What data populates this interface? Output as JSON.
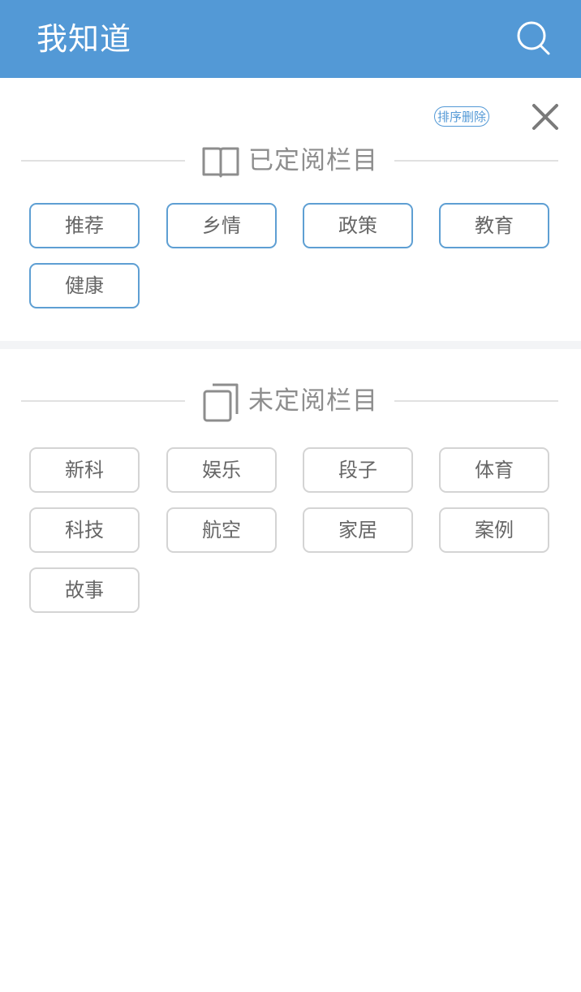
{
  "header": {
    "title": "我知道",
    "search_icon": "search-icon",
    "background": "#5399d6"
  },
  "panel": {
    "sort_delete_label": "排序删除",
    "close_icon": "close-icon"
  },
  "subscribed": {
    "title": "已定阅栏目",
    "icon": "open-book-icon",
    "accent": "#5e9fd3",
    "items": [
      "推荐",
      "乡情",
      "政策",
      "教育",
      "健康"
    ]
  },
  "unsubscribed": {
    "title": "未定阅栏目",
    "icon": "stacked-pages-icon",
    "border_color": "#d4d4d4",
    "items": [
      "新科",
      "娱乐",
      "段子",
      "体育",
      "科技",
      "航空",
      "家居",
      "案例",
      "故事"
    ]
  }
}
